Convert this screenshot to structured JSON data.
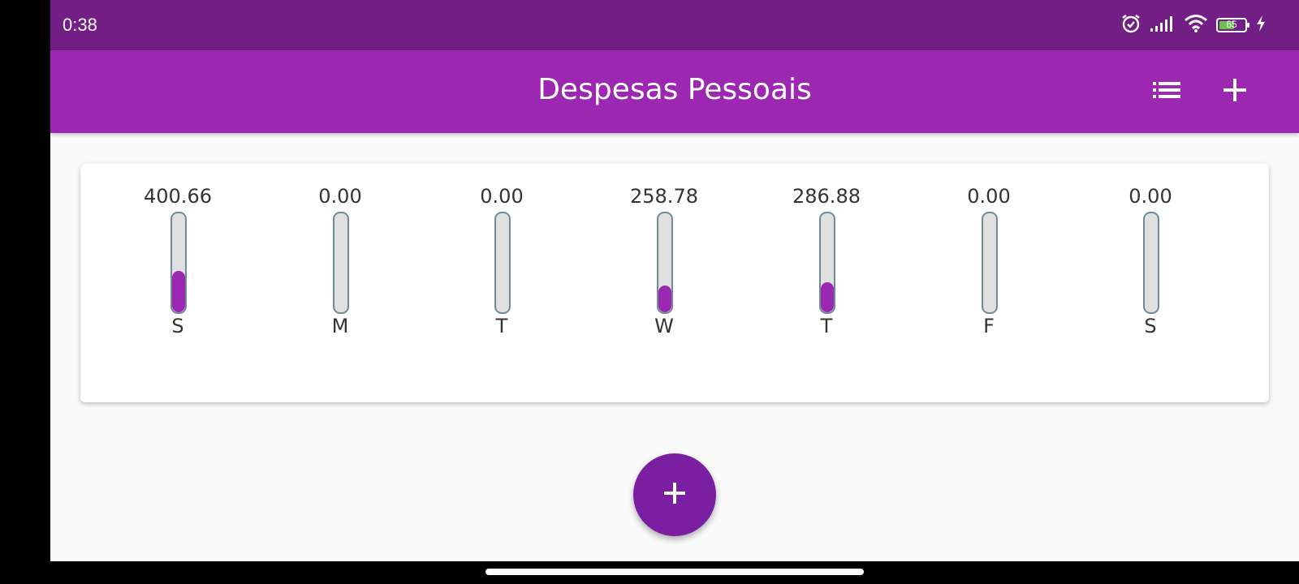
{
  "status_bar": {
    "time": "0:38",
    "battery_level": "65",
    "battery_fraction": 0.65,
    "icons": [
      "alarm-icon",
      "signal-icon",
      "wifi-icon",
      "battery-icon",
      "charging-icon"
    ]
  },
  "app_bar": {
    "title": "Despesas Pessoais",
    "actions": [
      "list-icon",
      "add-icon"
    ]
  },
  "colors": {
    "status_bar": "#731e84",
    "app_bar": "#9c27b0",
    "bar_fill": "#9c27b0",
    "bar_track": "#e0e0e0",
    "fab": "#7b1fa2",
    "background": "#fafafa"
  },
  "chart_data": {
    "type": "bar",
    "categories": [
      "S",
      "M",
      "T",
      "W",
      "T",
      "F",
      "S"
    ],
    "values": [
      400.66,
      0.0,
      0.0,
      258.78,
      286.88,
      0.0,
      0.0
    ],
    "value_labels": [
      "400.66",
      "0.00",
      "0.00",
      "258.78",
      "286.88",
      "0.00",
      "0.00"
    ],
    "fill_fraction": [
      0.42,
      0.0,
      0.0,
      0.27,
      0.3,
      0.0,
      0.0
    ]
  },
  "fab": {
    "icon": "add-icon"
  }
}
